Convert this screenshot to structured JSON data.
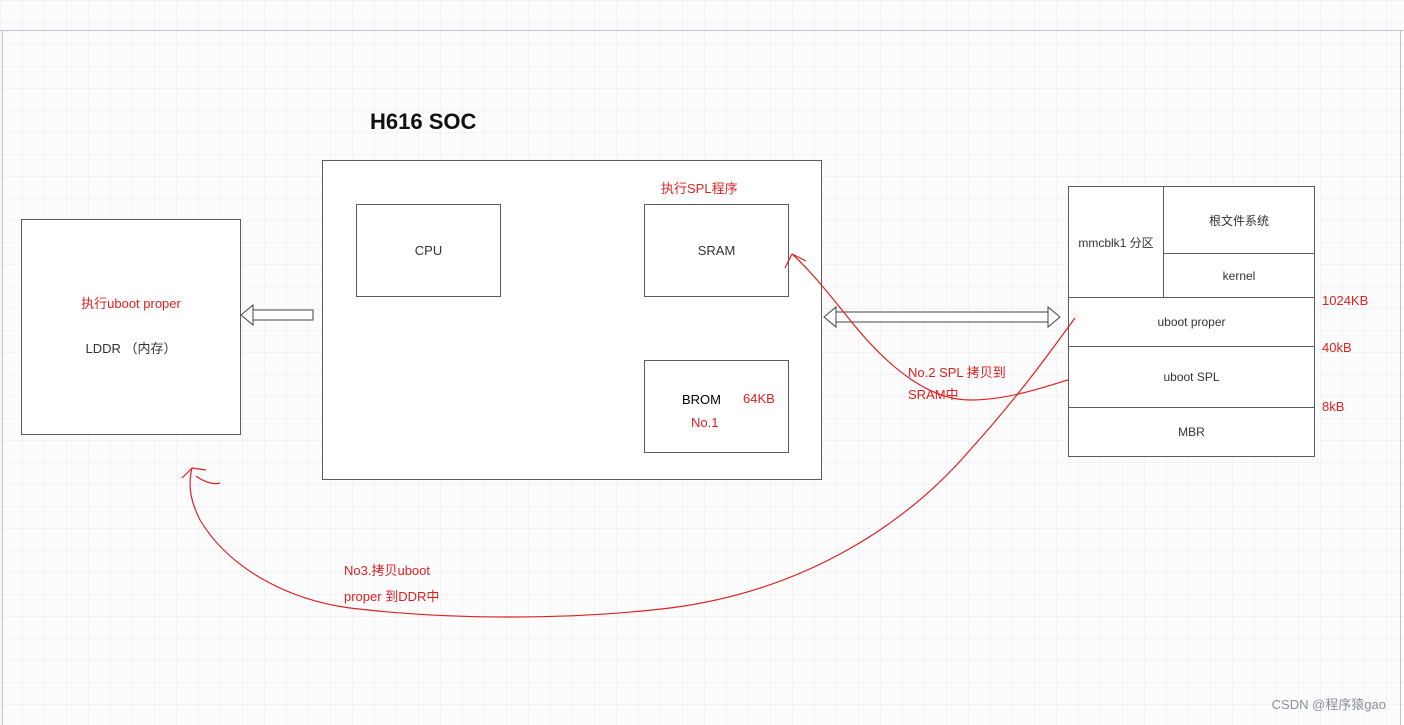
{
  "title": "H616 SOC",
  "lddr": {
    "label": "LDDR （内存）",
    "red_label": "执行uboot proper"
  },
  "soc": {
    "cpu": "CPU",
    "sram": "SRAM",
    "brom": "BROM",
    "brom_size": "64KB",
    "brom_step": "No.1",
    "spl_label": "执行SPL程序"
  },
  "emmc": {
    "mmc": "mmcblk1 分区",
    "rootfs": "根文件系统",
    "kernel": "kernel",
    "uboot_proper": "uboot proper",
    "uboot_spl": "uboot SPL",
    "mbr": "MBR",
    "size_1024": "1024KB",
    "size_40": "40kB",
    "size_8": "8kB"
  },
  "notes": {
    "no2_line1": "No.2 SPL 拷贝到",
    "no2_line2": "SRAM中",
    "no3_line1": "No3.拷贝uboot",
    "no3_line2": "proper 到DDR中"
  },
  "attribution": "CSDN @程序猿gao"
}
